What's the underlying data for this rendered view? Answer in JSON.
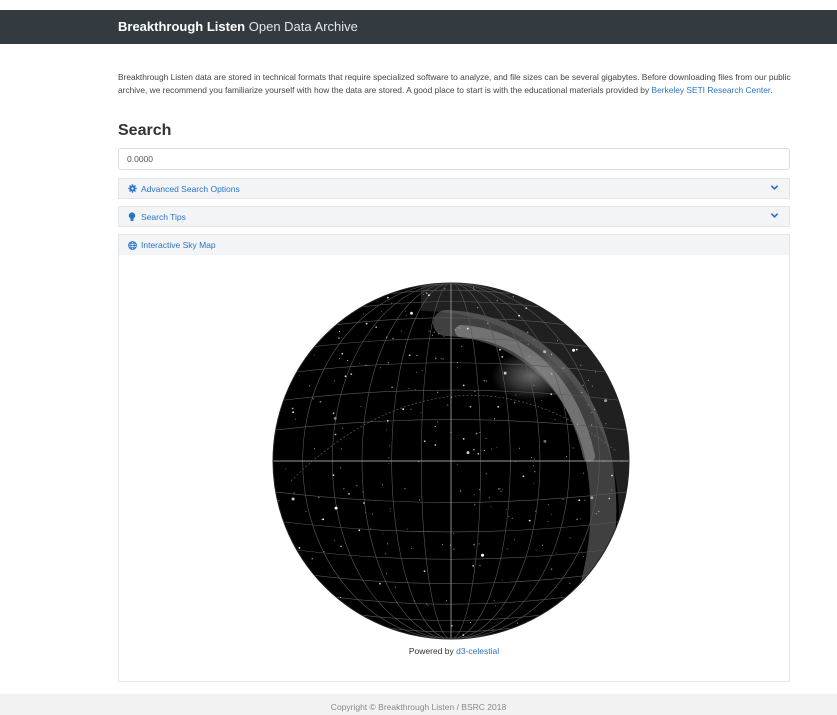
{
  "navbar": {
    "brand_bold": "Breakthrough Listen",
    "brand_light": "Open Data Archive"
  },
  "intro": {
    "text_1": "Breakthrough Listen data are stored in technical formats that require specialized software to analyze, and file sizes can be several gigabytes. Before downloading files from our public archive, we recommend you familiarize yourself with how the data are stored. A good place to start is with the educational materials provided by ",
    "link": "Berkeley SETI Research Center",
    "text_2": "."
  },
  "search": {
    "title": "Search",
    "value": "0.0000"
  },
  "panels": {
    "advanced": {
      "label": "Advanced Search Options",
      "icon": "gear-icon",
      "chevron": "chevron-down-icon"
    },
    "tips": {
      "label": "Search Tips",
      "icon": "lightbulb-icon",
      "chevron": "chevron-down-icon"
    },
    "skymap": {
      "label": "Interactive Sky Map",
      "icon": "globe-icon"
    }
  },
  "skymap": {
    "powered_by": "Powered by ",
    "powered_link": "d3-celestial"
  },
  "footer": {
    "copyright": "Copyright © Breakthrough Listen / BSRC 2018"
  },
  "colors": {
    "navbar": "#333a40",
    "link": "#2a73c9",
    "panel_bg": "#f3f4f5",
    "sky": "#000000"
  }
}
